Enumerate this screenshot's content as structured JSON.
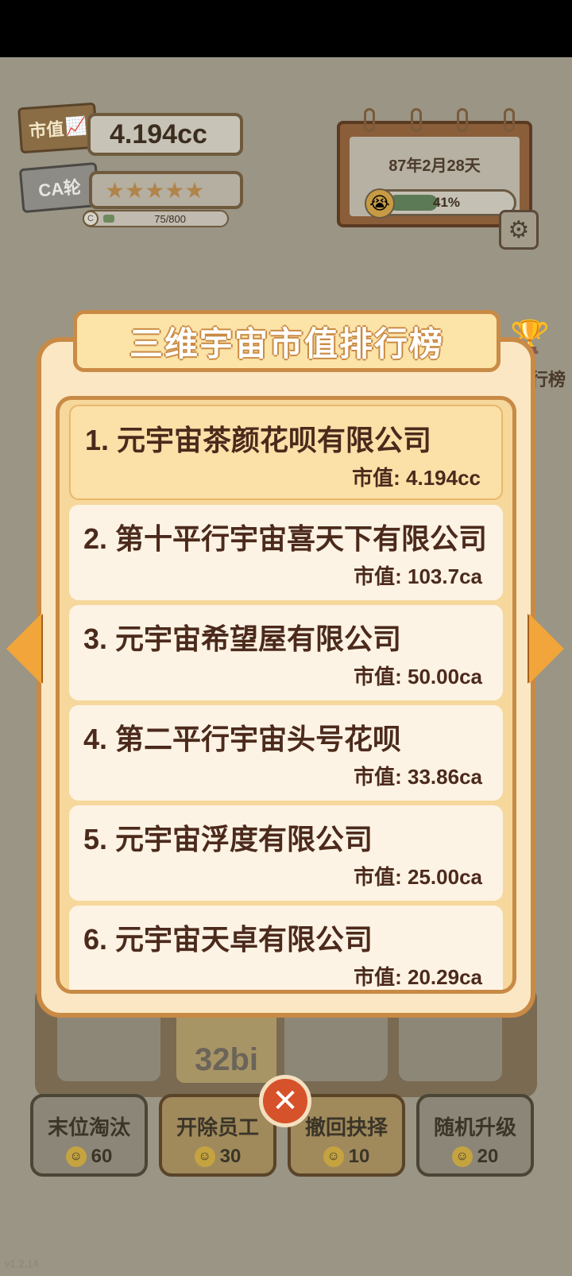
{
  "hud": {
    "market_value_label": "市值",
    "market_value": "4.194cc",
    "ca_label": "CA轮",
    "stars": "★★★★★",
    "progress_text": "75/800",
    "progress_fraction": 0.094,
    "progress_badge": "C"
  },
  "calendar": {
    "date": "87年2月28天",
    "percent_text": "41%",
    "percent": 0.41
  },
  "side": {
    "rank_label": "行榜"
  },
  "modal": {
    "title": "三维宇宙市值排行榜",
    "rows": [
      {
        "name": "1. 元宇宙茶颜花呗有限公司",
        "value": "市值: 4.194cc"
      },
      {
        "name": "2. 第十平行宇宙喜天下有限公司",
        "value": "市值: 103.7ca"
      },
      {
        "name": "3. 元宇宙希望屋有限公司",
        "value": "市值: 50.00ca"
      },
      {
        "name": "4. 第二平行宇宙头号花呗",
        "value": "市值: 33.86ca"
      },
      {
        "name": "5. 元宇宙浮度有限公司",
        "value": "市值: 25.00ca"
      },
      {
        "name": "6. 元宇宙天卓有限公司",
        "value": "市值: 20.29ca"
      }
    ]
  },
  "mascot_text": "32bi",
  "buttons": [
    {
      "label": "末位淘汰",
      "cost": "60"
    },
    {
      "label": "开除员工",
      "cost": "30"
    },
    {
      "label": "撤回抉择",
      "cost": "10"
    },
    {
      "label": "随机升级",
      "cost": "20"
    }
  ],
  "version": "v1.2.14",
  "colors": {
    "accent": "#f2a53a",
    "modal_bg": "#fbe7c4",
    "close": "#d6522a"
  }
}
